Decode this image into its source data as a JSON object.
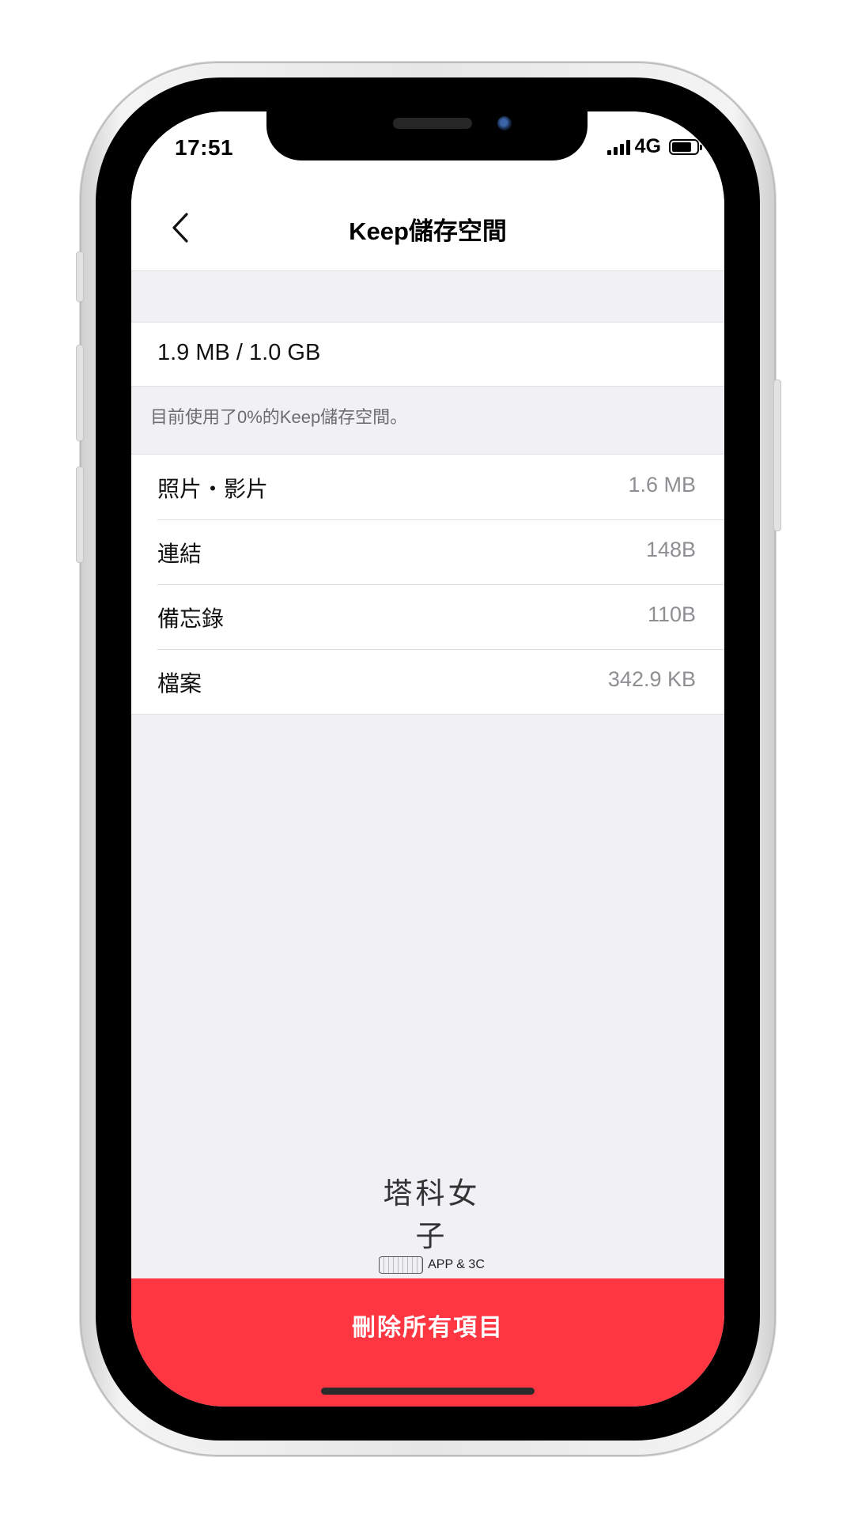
{
  "status_bar": {
    "time": "17:51",
    "network": "4G"
  },
  "nav": {
    "back_icon": "chevron-left-icon",
    "title": "Keep儲存空間"
  },
  "storage": {
    "usage": "1.9 MB / 1.0 GB",
    "note": "目前使用了0%的Keep儲存空間。"
  },
  "categories": [
    {
      "label": "照片・影片",
      "size": "1.6 MB"
    },
    {
      "label": "連結",
      "size": "148B"
    },
    {
      "label": "備忘錄",
      "size": "110B"
    },
    {
      "label": "檔案",
      "size": "342.9 KB"
    }
  ],
  "watermark": {
    "title": "塔科女子",
    "tag": "APP & 3C"
  },
  "actions": {
    "delete_all": "刪除所有項目"
  },
  "colors": {
    "delete_red": "#fd3642",
    "background": "#f0f0f5"
  }
}
